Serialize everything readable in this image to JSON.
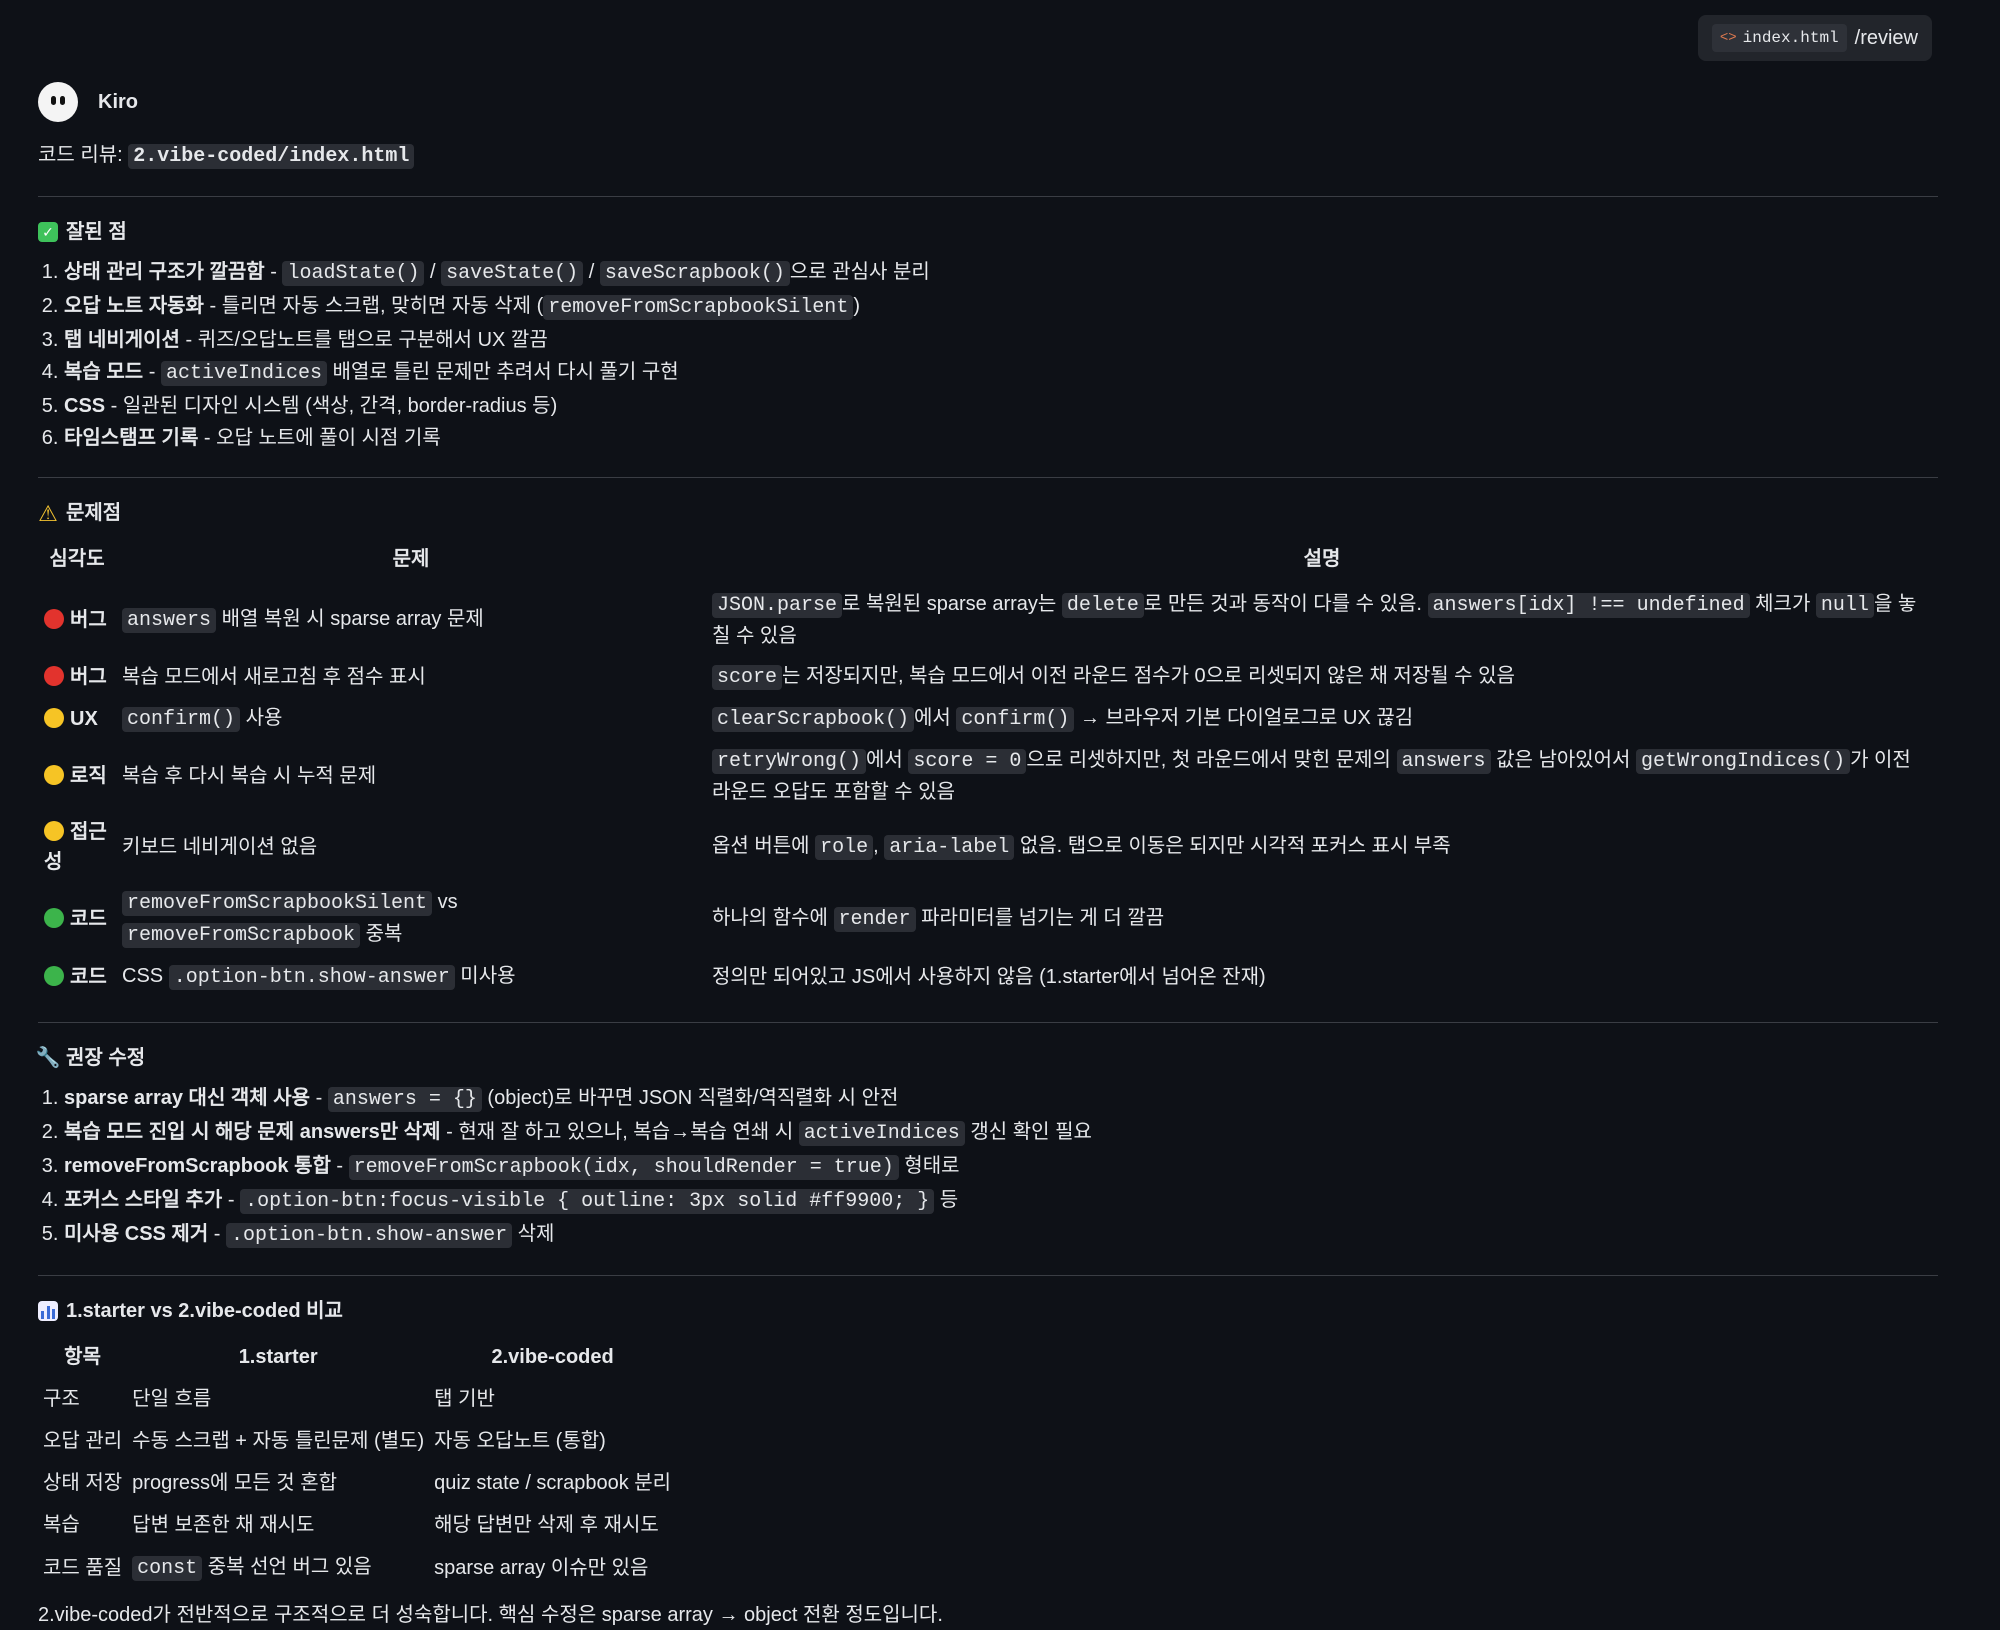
{
  "context_chip": {
    "file": "index.html",
    "command": "/review"
  },
  "agent": {
    "name": "Kiro"
  },
  "review_title": {
    "prefix": "코드 리뷰: ",
    "path": "2.vibe-coded/index.html"
  },
  "good": {
    "heading": "잘된 점",
    "items": [
      {
        "title": "상태 관리 구조가 깔끔함",
        "sep": " - ",
        "c1": "loadState()",
        "t1": " / ",
        "c2": "saveState()",
        "t2": " / ",
        "c3": "saveScrapbook()",
        "t3": "으로 관심사 분리"
      },
      {
        "title": "오답 노트 자동화",
        "sep": " - ",
        "t1": "틀리면 자동 스크랩, 맞히면 자동 삭제 (",
        "c1": "removeFromScrapbookSilent",
        "t2": ")"
      },
      {
        "title": "탭 네비게이션",
        "sep": " - ",
        "t1": "퀴즈/오답노트를 탭으로 구분해서 UX 깔끔"
      },
      {
        "title": "복습 모드",
        "sep": " - ",
        "c1": "activeIndices",
        "t1": " 배열로 틀린 문제만 추려서 다시 풀기 구현"
      },
      {
        "title": "CSS",
        "sep": " - ",
        "t1": "일관된 디자인 시스템 (색상, 간격, border-radius 등)"
      },
      {
        "title": "타임스탬프 기록",
        "sep": " - ",
        "t1": "오답 노트에 풀이 시점 기록"
      }
    ]
  },
  "issues": {
    "heading": "문제점",
    "headers": [
      "심각도",
      "문제",
      "설명"
    ],
    "rows": [
      {
        "color": "#e2332d",
        "severity": "버그",
        "problem": {
          "c1": "answers",
          "t1": " 배열 복원 시 sparse array 문제"
        },
        "desc": {
          "c1": "JSON.parse",
          "t1": "로 복원된 sparse array는 ",
          "c2": "delete",
          "t2": "로 만든 것과 동작이 다를 수 있음. ",
          "c3": "answers[idx] !== undefined",
          "t3": " 체크가 ",
          "c4": "null",
          "t4": "을 놓칠 수 있음"
        }
      },
      {
        "color": "#e2332d",
        "severity": "버그",
        "problem": {
          "t1": "복습 모드에서 새로고침 후 점수 표시"
        },
        "desc": {
          "c1": "score",
          "t1": "는 저장되지만, 복습 모드에서 이전 라운드 점수가 0으로 리셋되지 않은 채 저장될 수 있음"
        }
      },
      {
        "color": "#f6c425",
        "severity": "UX",
        "problem": {
          "c1": "confirm()",
          "t1": " 사용"
        },
        "desc": {
          "c1": "clearScrapbook()",
          "t1": "에서 ",
          "c2": "confirm()",
          "t2": " → 브라우저 기본 다이얼로그로 UX 끊김"
        }
      },
      {
        "color": "#f6c425",
        "severity": "로직",
        "problem": {
          "t1": "복습 후 다시 복습 시 누적 문제"
        },
        "desc": {
          "c1": "retryWrong()",
          "t1": "에서 ",
          "c2": "score = 0",
          "t2": "으로 리셋하지만, 첫 라운드에서 맞힌 문제의 ",
          "c3": "answers",
          "t3": " 값은 남아있어서 ",
          "c4": "getWrongIndices()",
          "t4": "가 이전 라운드 오답도 포함할 수 있음"
        }
      },
      {
        "color": "#f6c425",
        "severity": "접근성",
        "problem": {
          "t1": "키보드 네비게이션 없음"
        },
        "desc": {
          "t1": "옵션 버튼에 ",
          "c1": "role",
          "t2": ", ",
          "c2": "aria-label",
          "t3": " 없음. 탭으로 이동은 되지만 시각적 포커스 표시 부족"
        }
      },
      {
        "color": "#3cb44b",
        "severity": "코드",
        "problem": {
          "c1": "removeFromScrapbookSilent",
          "t1": " vs ",
          "c2": "removeFromScrapbook",
          "t2": " 중복"
        },
        "desc": {
          "t1": "하나의 함수에 ",
          "c1": "render",
          "t2": " 파라미터를 넘기는 게 더 깔끔"
        }
      },
      {
        "color": "#3cb44b",
        "severity": "코드",
        "problem": {
          "t1": "CSS ",
          "c1": ".option-btn.show-answer",
          "t2": " 미사용"
        },
        "desc": {
          "t1": "정의만 되어있고 JS에서 사용하지 않음 (1.starter에서 넘어온 잔재)"
        }
      }
    ]
  },
  "fixes": {
    "heading": "권장 수정",
    "items": [
      {
        "title": "sparse array 대신 객체 사용",
        "sep": " - ",
        "c1": "answers = {}",
        "t1": " (object)로 바꾸면 JSON 직렬화/역직렬화 시 안전"
      },
      {
        "title": "복습 모드 진입 시 해당 문제 answers만 삭제",
        "sep": " - ",
        "t1": "현재 잘 하고 있으나, 복습→복습 연쇄 시 ",
        "c1": "activeIndices",
        "t2": " 갱신 확인 필요"
      },
      {
        "title": "removeFromScrapbook 통합",
        "sep": " - ",
        "c1": "removeFromScrapbook(idx, shouldRender = true)",
        "t1": " 형태로"
      },
      {
        "title": "포커스 스타일 추가",
        "sep": " - ",
        "c1": ".option-btn:focus-visible { outline: 3px solid #ff9900; }",
        "t1": " 등"
      },
      {
        "title": "미사용 CSS 제거",
        "sep": " - ",
        "c1": ".option-btn.show-answer",
        "t1": " 삭제"
      }
    ]
  },
  "compare": {
    "heading": "1.starter vs 2.vibe-coded 비교",
    "headers": [
      "항목",
      "1.starter",
      "2.vibe-coded"
    ],
    "rows": [
      {
        "item": "구조",
        "starter_t1": "단일 흐름",
        "vibe": "탭 기반"
      },
      {
        "item": "오답 관리",
        "starter_t1": "수동 스크랩 + 자동 틀린문제 (별도)",
        "vibe": "자동 오답노트 (통합)"
      },
      {
        "item": "상태 저장",
        "starter_t1": "progress에 모든 것 혼합",
        "vibe": "quiz state / scrapbook 분리"
      },
      {
        "item": "복습",
        "starter_t1": "답변 보존한 채 재시도",
        "vibe": "해당 답변만 삭제 후 재시도"
      },
      {
        "item": "코드 품질",
        "starter_c1": "const",
        "starter_t2": " 중복 선언 버그 있음",
        "vibe": "sparse array 이슈만 있음"
      }
    ]
  },
  "summary": "2.vibe-coded가 전반적으로 구조적으로 더 성숙합니다. 핵심 수정은 sparse array → object 전환 정도입니다."
}
